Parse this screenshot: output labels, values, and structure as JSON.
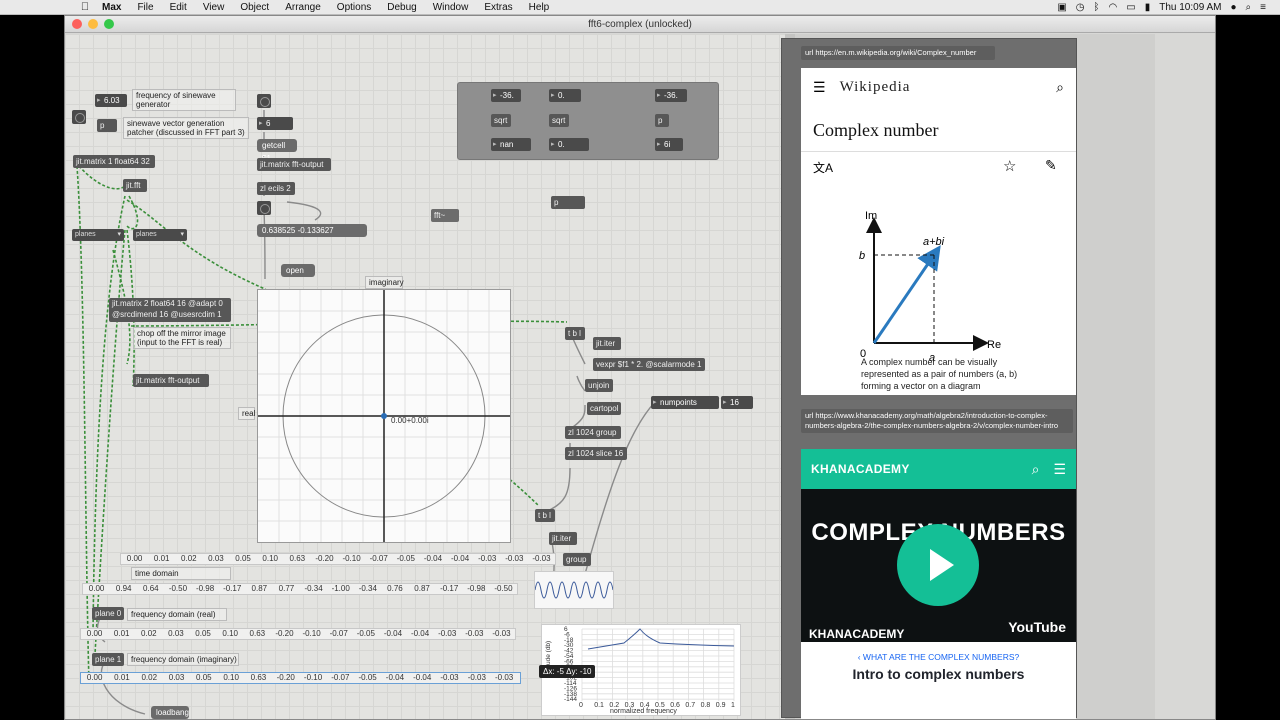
{
  "menubar": {
    "app": "Max",
    "items": [
      "File",
      "Edit",
      "View",
      "Object",
      "Arrange",
      "Options",
      "Debug",
      "Window",
      "Extras",
      "Help"
    ],
    "clock": "Thu 10:09 AM"
  },
  "window": {
    "title": "fft6-complex (unlocked)"
  },
  "patch": {
    "freq_number": "6.03",
    "freq_comment": "frequency of sinewave generator",
    "p_box": "p",
    "sine_comment": "sinewave vector generation patcher (discussed in FFT part 3)",
    "matrix1": "jit.matrix 1 float64 32",
    "jitfft": "jit.fft",
    "planes_a": "planes",
    "planes_b": "planes",
    "matrix2": "jit.matrix 2 float64 16 @adapt 0 @srcdimend 16 @usesrcdim 1",
    "mirror_comment": "chop off the mirror image (input to the FFT is real)",
    "fft_output_a": "jit.matrix fft-output",
    "six": "6",
    "getcell": "getcell $1",
    "fft_output_b": "jit.matrix fft-output",
    "zl_ecils": "zl ecils 2",
    "complex_value": "0.638525 -0.133627",
    "open": "open",
    "imaginary": "imaginary",
    "real": "real",
    "plot_readout": "0.00+0.00i",
    "fft_tilde": "fft~",
    "p_small": "p",
    "grid": {
      "a_num": "-36.",
      "a_sqrt": "sqrt",
      "a_out": "nan",
      "b_num": "0.",
      "b_sqrt": "sqrt",
      "b_out": "0.",
      "c_num": "-36.",
      "c_p": "p",
      "c_out": "6i"
    },
    "tbl1": "t b l",
    "jititer1": "jit.iter",
    "vexpr": "vexpr $f1 * 2. @scalarmode 1",
    "unjoin": "unjoin",
    "cartopol": "cartopol",
    "numpoints": "numpoints",
    "numpoints_val": "16",
    "zlgroup": "zl 1024 group",
    "zlslice": "zl 1024 slice 16",
    "tbl2": "t b l",
    "jititer2": "jit.iter",
    "group": "group",
    "time_domain": "time domain",
    "freq_real": "frequency domain (real)",
    "freq_imag": "frequency domain (imaginary)",
    "plane0": "plane 0",
    "plane1": "plane 1",
    "loadbang": "loadbang",
    "row_top": [
      "0.00",
      "0.01",
      "0.02",
      "0.03",
      "0.05",
      "0.10",
      "0.63",
      "-0.20",
      "-0.10",
      "-0.07",
      "-0.05",
      "-0.04",
      "-0.04",
      "-0.03",
      "-0.03",
      "-0.03"
    ],
    "row_time": [
      "0.00",
      "0.94",
      "0.64",
      "-0.50",
      "-0.98",
      "-0.17",
      "0.87",
      "0.77",
      "-0.34",
      "-1.00",
      "-0.34",
      "0.76",
      "0.87",
      "-0.17",
      "-0.98",
      "-0.50"
    ],
    "row_real": [
      "0.00",
      "0.01",
      "0.02",
      "0.03",
      "0.05",
      "0.10",
      "0.63",
      "-0.20",
      "-0.10",
      "-0.07",
      "-0.05",
      "-0.04",
      "-0.04",
      "-0.03",
      "-0.03",
      "-0.03"
    ],
    "row_imag": [
      "0.00",
      "0.01",
      "0.02",
      "0.03",
      "0.05",
      "0.10",
      "0.63",
      "-0.20",
      "-0.10",
      "-0.07",
      "-0.05",
      "-0.04",
      "-0.04",
      "-0.03",
      "-0.03",
      "-0.03"
    ],
    "tooltip": "Δx: -5 Δy: -10",
    "spectro_xlabel": "normalized frequency",
    "spectro_ylabel": "ude (db)",
    "spectro_yticks": [
      "6",
      "-6",
      "-18",
      "-30",
      "-42",
      "-54",
      "-66",
      "-78",
      "-90",
      "-102",
      "-114",
      "-126",
      "-138",
      "-144"
    ],
    "spectro_xticks": [
      "0",
      "0.1",
      "0.2",
      "0.3",
      "0.4",
      "0.5",
      "0.6",
      "0.7",
      "0.8",
      "0.9",
      "1"
    ]
  },
  "web1": {
    "url_msg": "url https://en.m.wikipedia.org/wiki/Complex_number",
    "brand": "Wikipedia",
    "title": "Complex number",
    "fig_im": "Im",
    "fig_re": "Re",
    "fig_abi": "a+bi",
    "fig_b": "b",
    "fig_a": "a",
    "fig_zero": "0",
    "caption": "A complex number can be visually represented as a pair of numbers (a, b) forming a vector on a diagram"
  },
  "web2": {
    "url_msg": "url https://www.khanacademy.org/math/algebra2/introduction-to-complex-numbers-algebra-2/the-complex-numbers-algebra-2/v/complex-number-intro",
    "logo": "KHANACADEMY",
    "video_title": "COMPLEX NUMBERS",
    "bottom_logo": "KHANACADEMY",
    "youtube": "YouTube",
    "question": "‹ WHAT ARE THE COMPLEX NUMBERS?",
    "lesson": "Intro to complex numbers"
  }
}
